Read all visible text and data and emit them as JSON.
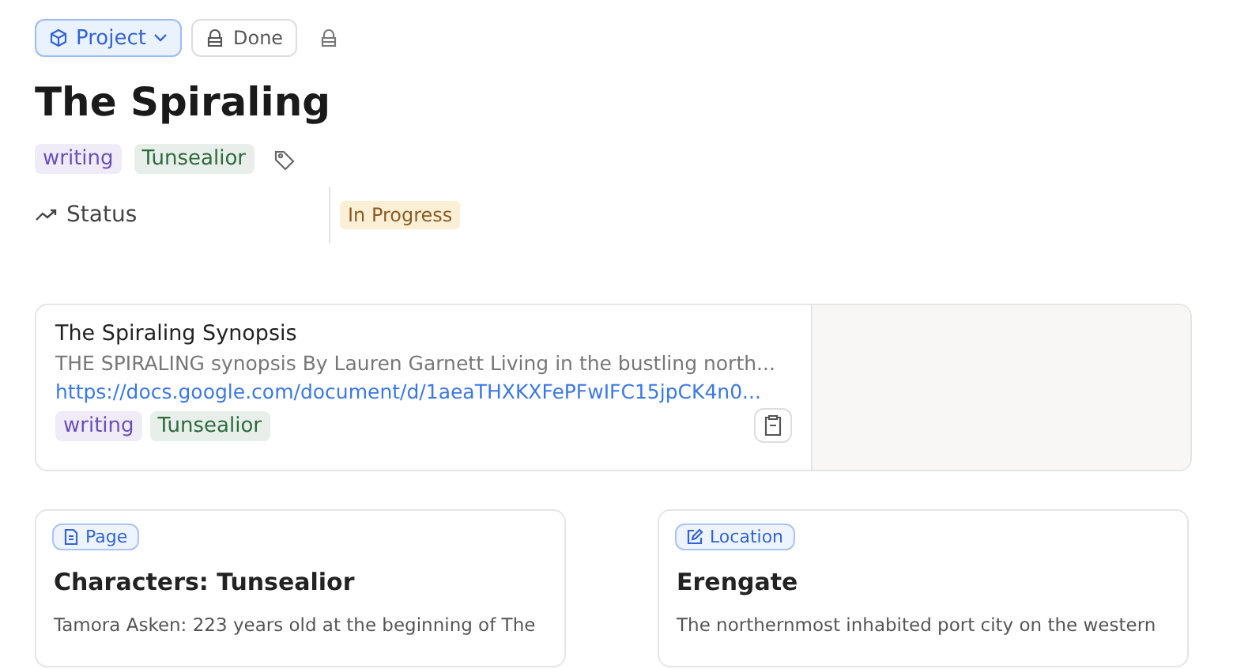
{
  "header": {
    "type_button": "Project",
    "status_button": "Done"
  },
  "title": "The Spiraling",
  "tags": [
    {
      "label": "writing",
      "color": "#6b4fbb"
    },
    {
      "label": "Tunsealior",
      "color": "#2e6b3e"
    }
  ],
  "properties": [
    {
      "label": "Status",
      "value": "In Progress"
    }
  ],
  "linked_doc": {
    "title": "The Spiraling Synopsis",
    "excerpt": "THE SPIRALING synopsis By Lauren Garnett Living in the bustling north...",
    "url": "https://docs.google.com/document/d/1aeaTHXKXFePFwIFC15jpCK4n0...",
    "tags": [
      {
        "label": "writing",
        "color": "#6b4fbb"
      },
      {
        "label": "Tunsealior",
        "color": "#2e6b3e"
      }
    ]
  },
  "cards": [
    {
      "kind": "page",
      "badge": "Page",
      "title": "Characters: Tunsealior",
      "text": "Tamora Asken: 223 years old at the beginning of The"
    },
    {
      "kind": "location",
      "badge": "Location",
      "title": "Erengate",
      "text": "The northernmost inhabited port city on the western"
    }
  ]
}
